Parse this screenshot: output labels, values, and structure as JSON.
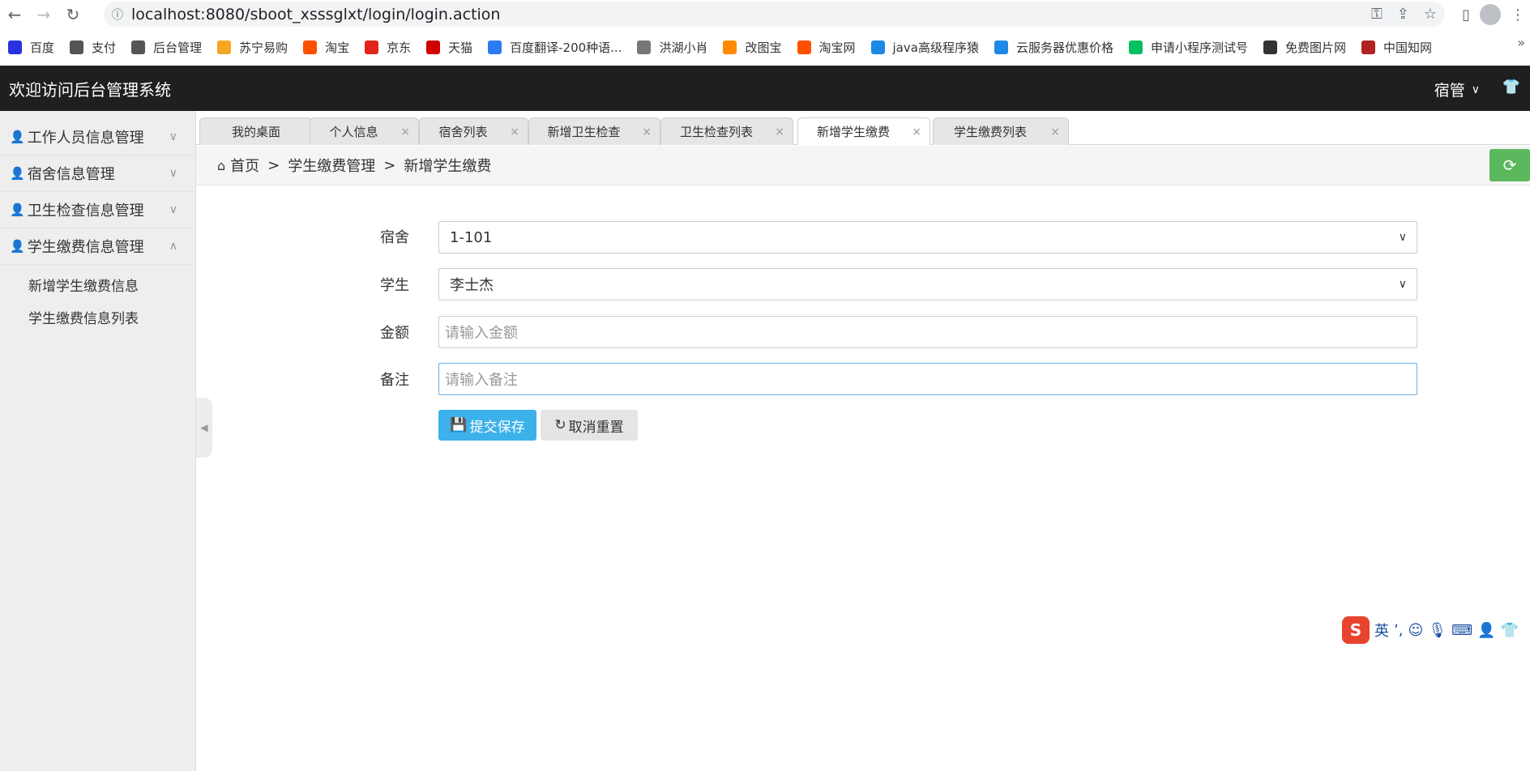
{
  "browser": {
    "url": "localhost:8080/sboot_xsssglxt/login/login.action",
    "bookmarks": [
      {
        "label": "百度",
        "icon": "baidu-icon",
        "color": "#2932e1"
      },
      {
        "label": "支付",
        "icon": "globe-icon",
        "color": "#555555"
      },
      {
        "label": "后台管理",
        "icon": "globe-icon",
        "color": "#555555"
      },
      {
        "label": "苏宁易购",
        "icon": "suning-icon",
        "color": "#f5a623"
      },
      {
        "label": "淘宝",
        "icon": "taobao-icon",
        "color": "#ff5000"
      },
      {
        "label": "京东",
        "icon": "jd-icon",
        "color": "#e1251b"
      },
      {
        "label": "天猫",
        "icon": "tmall-icon",
        "color": "#d00000"
      },
      {
        "label": "百度翻译-200种语...",
        "icon": "translate-icon",
        "color": "#2b7bf2"
      },
      {
        "label": "洪湖小肖",
        "icon": "bird-icon",
        "color": "#777777"
      },
      {
        "label": "改图宝",
        "icon": "gaitubao-icon",
        "color": "#ff8a00"
      },
      {
        "label": "淘宝网",
        "icon": "taobao-icon",
        "color": "#ff5000"
      },
      {
        "label": "java高级程序猿",
        "icon": "bilibili-icon",
        "color": "#1e88e5"
      },
      {
        "label": "云服务器优惠价格",
        "icon": "cloud-icon",
        "color": "#1e88e5"
      },
      {
        "label": "申请小程序测试号",
        "icon": "wechat-icon",
        "color": "#07c160"
      },
      {
        "label": "免费图片网",
        "icon": "t-icon",
        "color": "#333333"
      },
      {
        "label": "中国知网",
        "icon": "cnki-icon",
        "color": "#b22222"
      }
    ]
  },
  "header": {
    "title": "欢迎访问后台管理系统",
    "user": "宿管"
  },
  "sidebar": {
    "items": [
      {
        "label": "工作人员信息管理",
        "expanded": false
      },
      {
        "label": "宿舍信息管理",
        "expanded": false
      },
      {
        "label": "卫生检查信息管理",
        "expanded": false
      },
      {
        "label": "学生缴费信息管理",
        "expanded": true
      }
    ],
    "subitems": [
      "新增学生缴费信息",
      "学生缴费信息列表"
    ]
  },
  "tabs": [
    {
      "label": "我的桌面",
      "closable": false
    },
    {
      "label": "个人信息",
      "closable": true
    },
    {
      "label": "宿舍列表",
      "closable": true
    },
    {
      "label": "新增卫生检查",
      "closable": true
    },
    {
      "label": "卫生检查列表",
      "closable": true
    },
    {
      "label": "新增学生缴费",
      "closable": true,
      "active": true
    },
    {
      "label": "学生缴费列表",
      "closable": true
    }
  ],
  "breadcrumb": {
    "home": "首页",
    "level1": "学生缴费管理",
    "level2": "新增学生缴费"
  },
  "form": {
    "dorm_label": "宿舍",
    "dorm_value": "1-101",
    "student_label": "学生",
    "student_value": "李士杰",
    "amount_label": "金额",
    "amount_placeholder": "请输入金额",
    "remark_label": "备注",
    "remark_placeholder": "请输入备注",
    "submit_label": "提交保存",
    "reset_label": "取消重置"
  },
  "ime": {
    "logo": "S",
    "mode": "英"
  },
  "colors": {
    "header_bg": "#1f1f1f",
    "submit_bg": "#3db1ea",
    "refresh_bg": "#5cb85c"
  }
}
